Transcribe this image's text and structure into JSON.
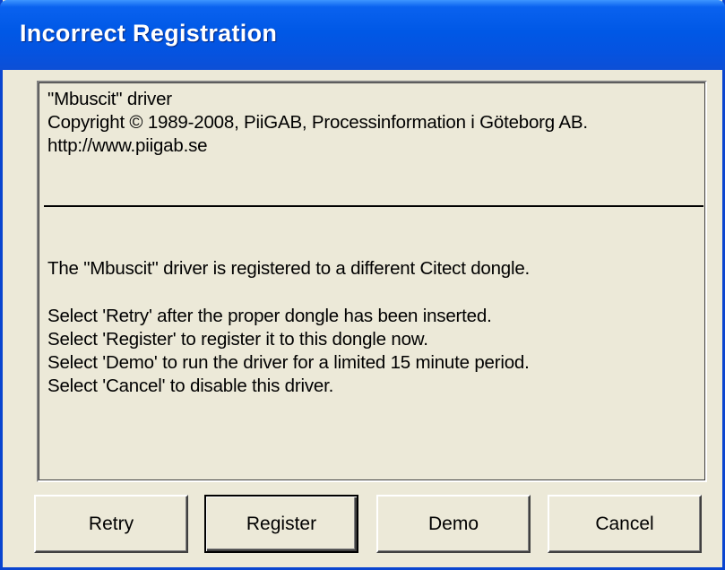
{
  "window": {
    "title": "Incorrect Registration"
  },
  "message": {
    "header_lines": [
      "\"Mbuscit\" driver",
      "Copyright © 1989-2008, PiiGAB, Processinformation i Göteborg AB.",
      "http://www.piigab.se"
    ],
    "status": "The \"Mbuscit\" driver is registered to a different Citect dongle.",
    "instructions": [
      "Select 'Retry' after the proper dongle has been inserted.",
      "Select 'Register' to register it to this dongle now.",
      "Select 'Demo' to run the driver for a limited 15 minute period.",
      "Select 'Cancel' to disable this driver."
    ]
  },
  "buttons": {
    "retry": "Retry",
    "register": "Register",
    "demo": "Demo",
    "cancel": "Cancel"
  },
  "colors": {
    "titlebar": "#0058e6",
    "dialog_bg": "#ece9d8",
    "title_text": "#ffffff"
  }
}
